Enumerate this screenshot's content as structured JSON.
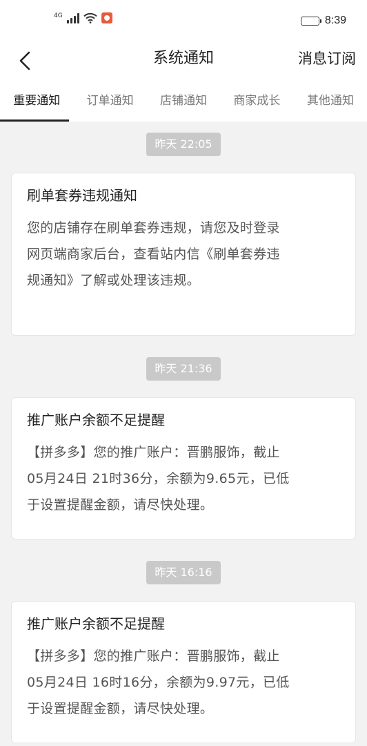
{
  "status_bar": {
    "network": "4G",
    "time": "8:39",
    "battery_level": 0.9
  },
  "header": {
    "back_icon": "chevron-left-icon",
    "title": "系统通知",
    "action": "消息订阅"
  },
  "tabs": [
    {
      "label": "重要通知",
      "active": true
    },
    {
      "label": "订单通知",
      "active": false
    },
    {
      "label": "店铺通知",
      "active": false
    },
    {
      "label": "商家成长",
      "active": false
    },
    {
      "label": "其他通知",
      "active": false
    }
  ],
  "notifications": [
    {
      "time": "昨天 22:05",
      "title": "刷单套券违规通知",
      "lines": [
        "您的店铺存在刷单套券违规，请您及时登录",
        "网页端商家后台，查看站内信《刷单套券违",
        "规通知》了解或处理该违规。"
      ]
    },
    {
      "time": "昨天 21:36",
      "title": "推广账户余额不足提醒",
      "lines": [
        "【拼多多】您的推广账户：晋鹏服饰，截止",
        "05月24日 21时36分，余额为9.65元，已低",
        "于设置提醒金额，请尽快处理。"
      ]
    },
    {
      "time": "昨天 16:16",
      "title": "推广账户余额不足提醒",
      "lines": [
        "【拼多多】您的推广账户：晋鹏服饰，截止",
        "05月24日 16时16分，余额为9.97元，已低",
        "于设置提醒金额，请尽快处理。"
      ]
    }
  ],
  "colors": {
    "background": "#f2f2f2",
    "timestamp_badge": "#c9c9c9",
    "card": "#ffffff",
    "tab_active": "#111111",
    "tab_inactive": "#777777"
  }
}
